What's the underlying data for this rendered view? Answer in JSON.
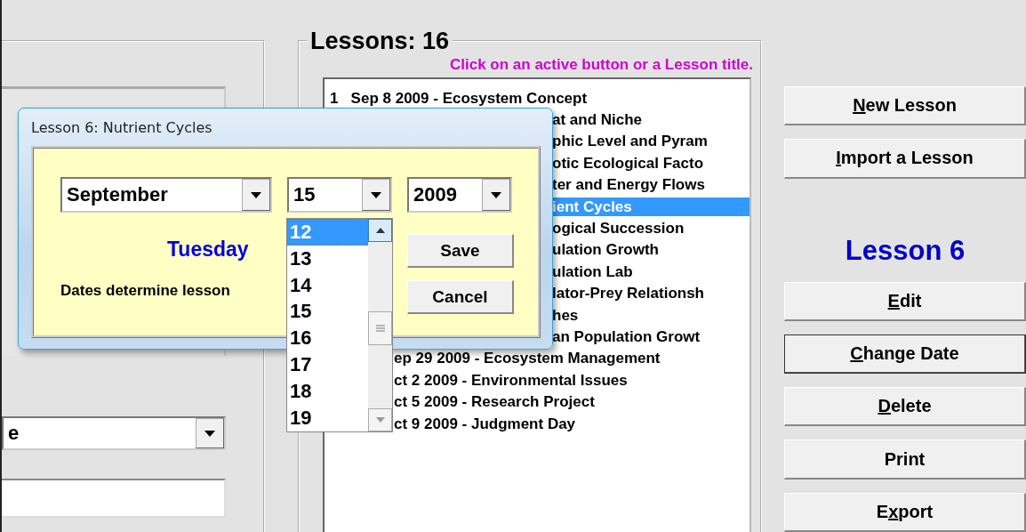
{
  "left_panel": {
    "combo_value": "e"
  },
  "lessons_panel": {
    "title": "Lessons: 16",
    "hint": "Click on an active button or a Lesson title.",
    "items": [
      {
        "text": "1   Sep 8 2009 - Ecosystem Concept",
        "selected": false,
        "kind": "full"
      },
      {
        "text": "at and Niche",
        "selected": false,
        "kind": "dialog"
      },
      {
        "text": "phic Level and Pyram",
        "selected": false,
        "kind": "dialog"
      },
      {
        "text": "otic Ecological Facto",
        "selected": false,
        "kind": "dialog"
      },
      {
        "text": "ter and Energy Flows",
        "selected": false,
        "kind": "dialog"
      },
      {
        "text": "ient Cycles",
        "selected": true,
        "kind": "dialog"
      },
      {
        "text": "ogical Succession",
        "selected": false,
        "kind": "dialog"
      },
      {
        "text": "ulation Growth",
        "selected": false,
        "kind": "dialog"
      },
      {
        "text": "ulation Lab",
        "selected": false,
        "kind": "dialog"
      },
      {
        "text": "lator-Prey Relationsh",
        "selected": false,
        "kind": "dialog"
      },
      {
        "text": "hes",
        "selected": false,
        "kind": "dialog"
      },
      {
        "text": "an Population Growt",
        "selected": false,
        "kind": "dialog"
      },
      {
        "text": "ep 29 2009 - Ecosystem Management",
        "selected": false,
        "kind": "dropdown"
      },
      {
        "text": "ct 2 2009 - Environmental Issues",
        "selected": false,
        "kind": "dropdown"
      },
      {
        "text": "ct 5 2009 - Research Project",
        "selected": false,
        "kind": "dropdown"
      },
      {
        "text": "ct 9 2009 - Judgment Day",
        "selected": false,
        "kind": "dropdown"
      }
    ]
  },
  "actions": {
    "top_buttons": [
      {
        "underlined": "N",
        "text_after": "ew Lesson",
        "default": false
      },
      {
        "underlined": "I",
        "text_after": "mport a Lesson",
        "default": false
      }
    ],
    "current_lesson": "Lesson 6",
    "lesson_buttons": [
      {
        "underlined": "E",
        "text_after": "dit",
        "default": false
      },
      {
        "underlined": "C",
        "text_after": "hange Date",
        "default": true
      },
      {
        "underlined": "D",
        "text_after": "elete",
        "default": false
      },
      {
        "text_before": "Print",
        "default": false
      },
      {
        "text_before": "E",
        "underlined": "x",
        "text_after": "port",
        "default": false
      }
    ]
  },
  "dialog": {
    "title": "Lesson 6: Nutrient Cycles",
    "month": "September",
    "day": "15",
    "year": "2009",
    "day_list": [
      {
        "label": "12",
        "selected": true
      },
      {
        "label": "13",
        "selected": false
      },
      {
        "label": "14",
        "selected": false
      },
      {
        "label": "15",
        "selected": false
      },
      {
        "label": "16",
        "selected": false
      },
      {
        "label": "17",
        "selected": false
      },
      {
        "label": "18",
        "selected": false
      },
      {
        "label": "19",
        "selected": false
      }
    ],
    "weekday": "Tuesday",
    "note": "Dates determine lesson",
    "buttons": [
      "Save",
      "Cancel"
    ]
  }
}
